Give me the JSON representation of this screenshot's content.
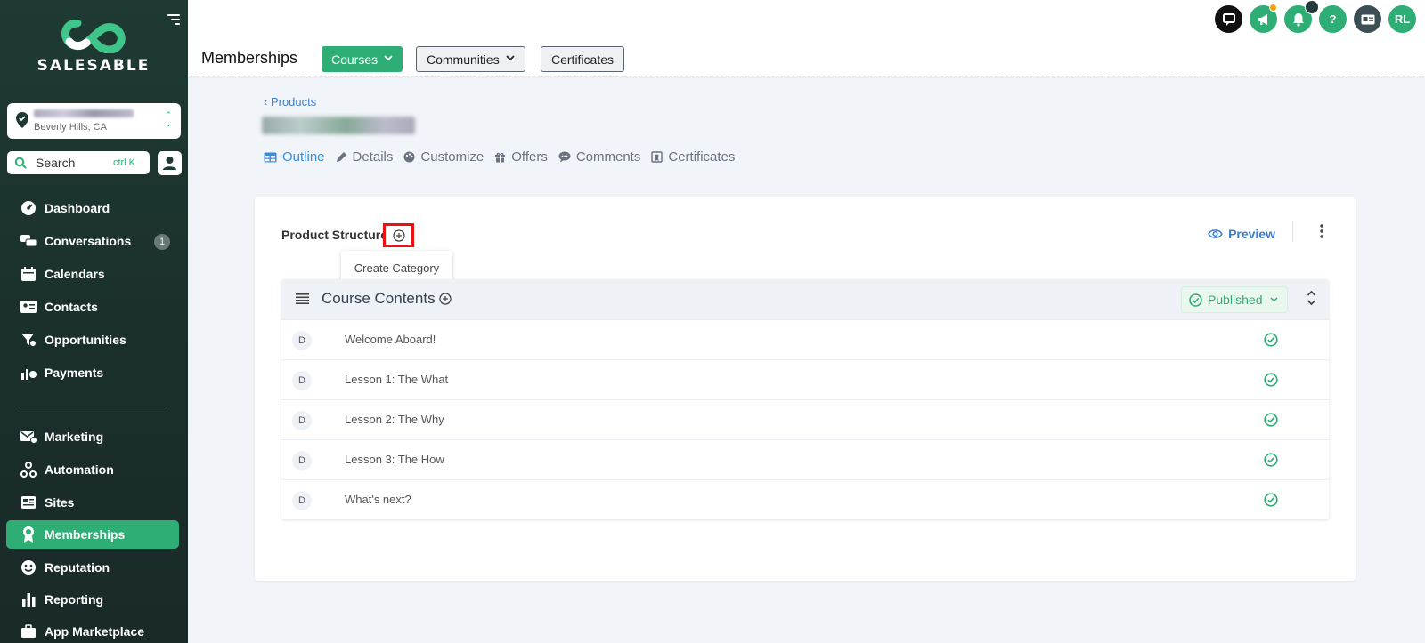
{
  "sidebar": {
    "brand": "SALESABLE",
    "location": {
      "city": "Beverly Hills, CA"
    },
    "search": {
      "label": "Search",
      "shortcut": "ctrl K"
    },
    "items": [
      {
        "label": "Dashboard",
        "icon": "dashboard-icon"
      },
      {
        "label": "Conversations",
        "icon": "chat-bubbles-icon",
        "badge": "1"
      },
      {
        "label": "Calendars",
        "icon": "calendar-icon"
      },
      {
        "label": "Contacts",
        "icon": "contact-card-icon"
      },
      {
        "label": "Opportunities",
        "icon": "funnel-icon"
      },
      {
        "label": "Payments",
        "icon": "payments-icon"
      },
      {
        "label": "Marketing",
        "icon": "megaphone-mail-icon"
      },
      {
        "label": "Automation",
        "icon": "automation-icon"
      },
      {
        "label": "Sites",
        "icon": "sites-icon"
      },
      {
        "label": "Memberships",
        "icon": "award-icon",
        "active": true
      },
      {
        "label": "Reputation",
        "icon": "smiley-icon"
      },
      {
        "label": "Reporting",
        "icon": "bar-chart-icon"
      },
      {
        "label": "App Marketplace",
        "icon": "briefcase-icon"
      }
    ]
  },
  "topbar": {
    "avatar_initials": "RL",
    "help": "?"
  },
  "subbar": {
    "title": "Memberships",
    "tabs": [
      {
        "label": "Courses",
        "active": true
      },
      {
        "label": "Communities"
      },
      {
        "label": "Certificates"
      }
    ]
  },
  "page": {
    "breadcrumb": "Products",
    "tabs": [
      "Outline",
      "Details",
      "Customize",
      "Offers",
      "Comments",
      "Certificates"
    ]
  },
  "card": {
    "title": "Product Structure",
    "tooltip": "Create Category",
    "preview": "Preview",
    "category": {
      "title": "Course Contents",
      "status": "Published",
      "lessons": [
        "Welcome Aboard!",
        "Lesson 1: The What",
        "Lesson 2: The Why",
        "Lesson 3: The How",
        "What's next?"
      ]
    }
  },
  "colors": {
    "brand_green": "#2eae74",
    "sidebar_dark": "#1f3a33",
    "link_blue": "#3a7dcf",
    "highlight_red": "#ee1111"
  }
}
